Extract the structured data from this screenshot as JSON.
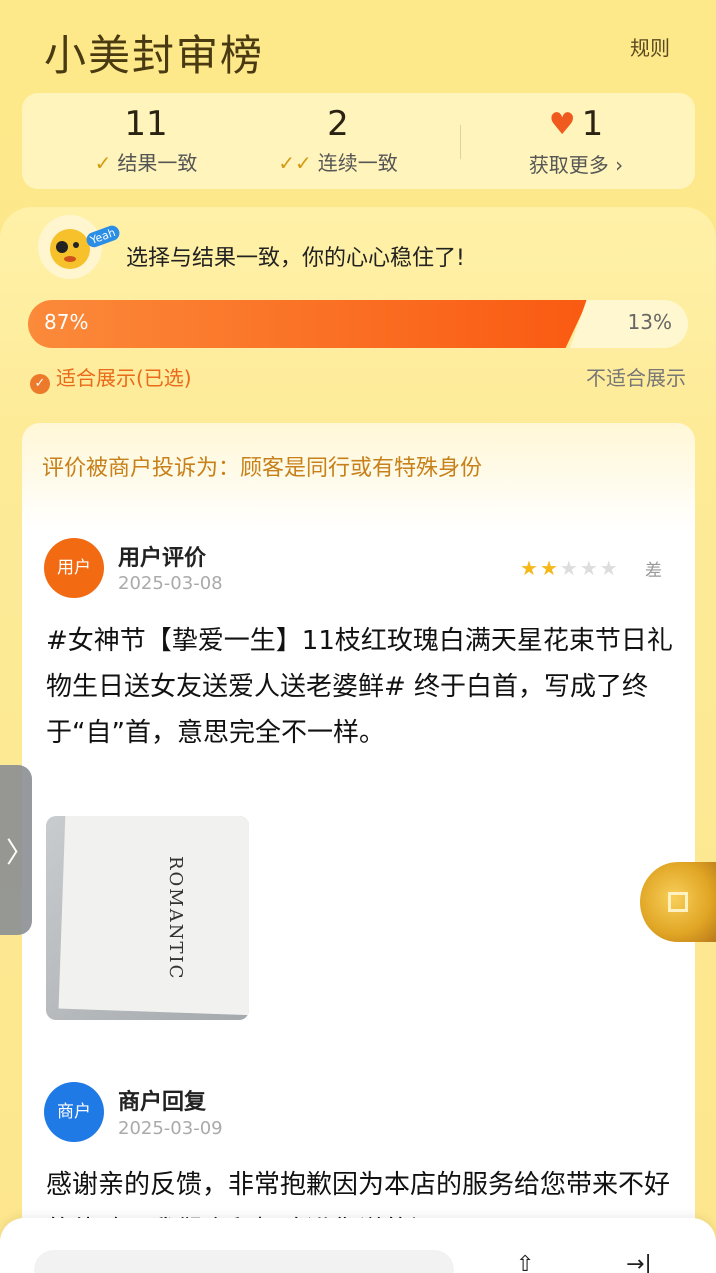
{
  "header": {
    "title": "小美封审榜",
    "rules_link": "规则"
  },
  "stats": {
    "consistent_count": "11",
    "consistent_label": "结果一致",
    "streak_count": "2",
    "streak_label": "连续一致",
    "hearts_count": "1",
    "more_label": "获取更多 ›"
  },
  "result": {
    "mascot_text": "Yeah",
    "headline": "选择与结果一致，你的心心稳住了!",
    "suitable_percent": "87%",
    "unsuitable_percent": "13%",
    "suitable_label": "适合展示(已选)",
    "unsuitable_label": "不适合展示"
  },
  "card": {
    "complaint": "评价被商户投诉为：顾客是同行或有特殊身份",
    "user_avatar": "用户",
    "user_name": "用户评价",
    "user_date": "2025-03-08",
    "rating_word": "差",
    "rating": 2,
    "review_text": "#女神节【挚爱一生】11枝红玫瑰白满天星花束节日礼物生日送女友送爱人送老婆鲜# 终于白首，写成了终于“自”首，意思完全不一样。",
    "photo_word": "ROMANTIC",
    "merchant_avatar": "商户",
    "merchant_name": "商户回复",
    "merchant_date": "2025-03-09",
    "reply_text": "感谢亲的反馈，非常抱歉因为本店的服务给您带来不好的体验，我们会积极改进您说的问题"
  },
  "colors": {
    "accent": "#fa5a12",
    "brand_yellow": "#fde68c",
    "merchant_blue": "#1f7ae6"
  }
}
